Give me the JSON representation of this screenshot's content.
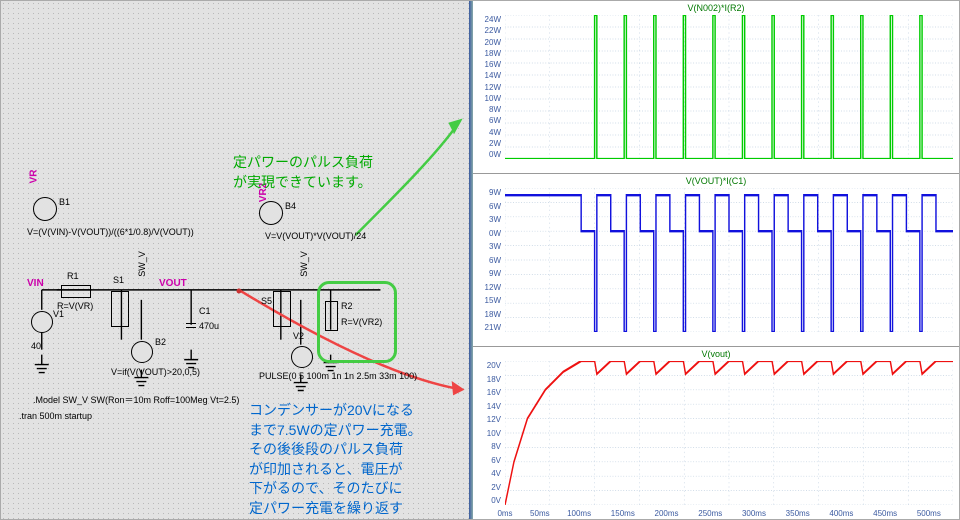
{
  "schematic": {
    "nets": {
      "vin": "VIN",
      "vout": "VOUT",
      "vr": "VR",
      "vr2": "VR2",
      "sw_v1": "SW_V",
      "sw_v2": "SW_V"
    },
    "labels": {
      "b1": "B1",
      "b1_expr": "V=(V(VIN)-V(VOUT))/((6*1/0.8)/V(VOUT))",
      "b4": "B4",
      "b4_expr": "V=V(VOUT)*V(VOUT)/24",
      "v1": "V1",
      "v1_val": "40",
      "r1": "R1",
      "r1_val": "R=V(VR)",
      "s1": "S1",
      "s5": "S5",
      "c1": "C1",
      "c1_val": "470u",
      "b2": "B2",
      "b2_expr": "V=if(V(VOUT)>20,0,5)",
      "v2": "V2",
      "v2_expr": "PULSE(0 5 100m 1n 1n 2.5m 33m 100)",
      "r2": "R2",
      "r2_val": "R=V(VR2)",
      "model": ".Model SW_V SW(Ron＝10m Roff=100Meg Vt=2.5)",
      "tran": ".tran 500m startup"
    },
    "annotations": {
      "green1": "定パワーのパルス負荷",
      "green2": "が実現できています。",
      "blue1": "コンデンサーが20Vになる",
      "blue2": "まで7.5Wの定パワー充電。",
      "blue3": "その後後段のパルス負荷",
      "blue4": "が印加されると、電圧が",
      "blue5": "下がるので、そのたびに",
      "blue6": "定パワー充電を繰り返す"
    }
  },
  "chart_data": [
    {
      "type": "line",
      "title": "V(N002)*I(R2)",
      "color": "#0c0",
      "ylim": [
        0,
        24
      ],
      "yunit": "W",
      "xrange": [
        0,
        500
      ],
      "xunit": "ms",
      "yticks": [
        "24W",
        "22W",
        "20W",
        "18W",
        "16W",
        "14W",
        "12W",
        "10W",
        "8W",
        "6W",
        "4W",
        "2W",
        "0W"
      ],
      "xticks": [
        "0ms",
        "50ms",
        "100ms",
        "150ms",
        "200ms",
        "250ms",
        "300ms",
        "350ms",
        "400ms",
        "450ms",
        "500ms"
      ],
      "pulses": {
        "t0": 100,
        "period": 33,
        "width": 2.5,
        "count": 12,
        "high": 24,
        "low": 0
      }
    },
    {
      "type": "line",
      "title": "V(VOUT)*I(C1)",
      "color": "#11d",
      "ylim": [
        -21,
        9
      ],
      "yunit": "W",
      "xrange": [
        0,
        500
      ],
      "xunit": "ms",
      "yticks": [
        "9W",
        "6W",
        "3W",
        "0W",
        "3W",
        "6W",
        "9W",
        "12W",
        "15W",
        "18W",
        "21W"
      ],
      "xticks": [
        "0ms",
        "50ms",
        "100ms",
        "150ms",
        "200ms",
        "250ms",
        "300ms",
        "350ms",
        "400ms",
        "450ms",
        "500ms"
      ],
      "description": "starts at ~7.5W charge until ~85ms then drops to 0; at each pulse dips to about -21W briefly then recharges at ~7.5W back toward 0"
    },
    {
      "type": "line",
      "title": "V(vout)",
      "color": "#e11",
      "ylim": [
        0,
        20
      ],
      "yunit": "V",
      "xrange": [
        0,
        500
      ],
      "xunit": "ms",
      "yticks": [
        "20V",
        "18V",
        "16V",
        "14V",
        "12V",
        "10V",
        "8V",
        "6V",
        "4V",
        "2V",
        "0V"
      ],
      "xticks": [
        "0ms",
        "50ms",
        "100ms",
        "150ms",
        "200ms",
        "250ms",
        "300ms",
        "350ms",
        "400ms",
        "450ms",
        "500ms"
      ],
      "description": "ramps from 0 to 20V by ~85ms; each load pulse drops Vout ~1.5V then recharges back to 20V; repeats each 33ms"
    }
  ]
}
